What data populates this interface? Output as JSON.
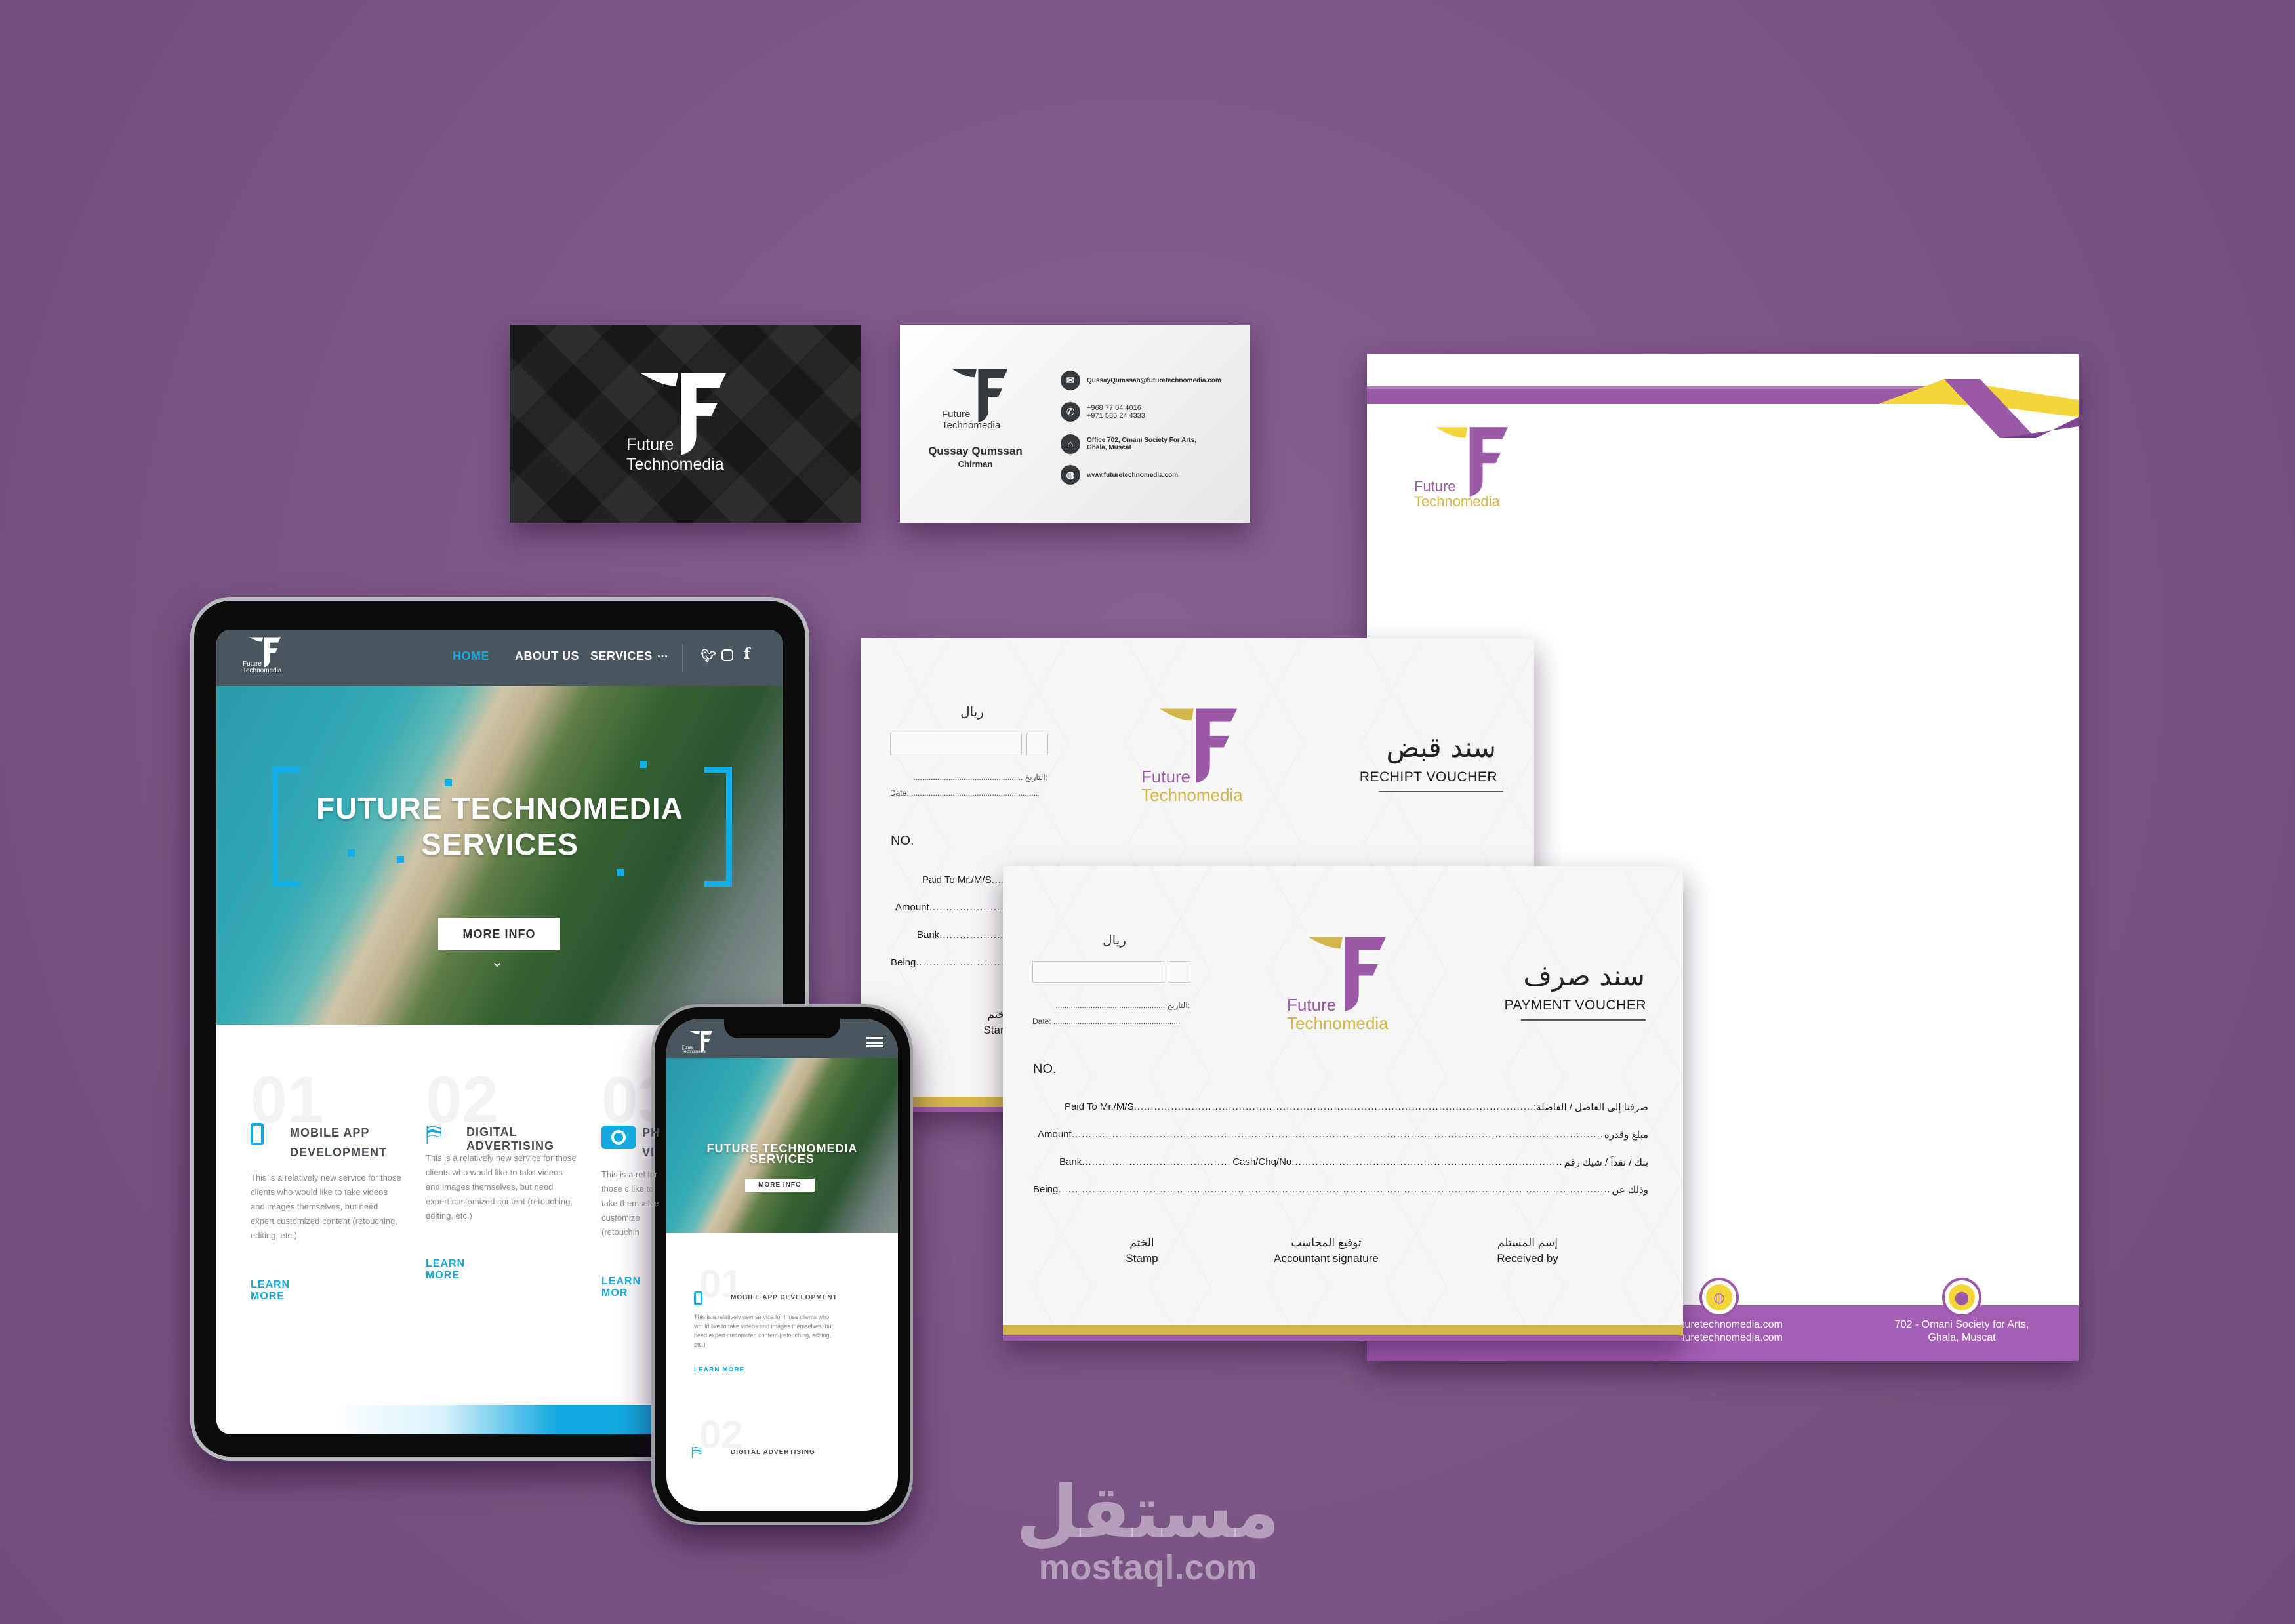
{
  "brand": {
    "line1": "Future",
    "line2": "Technomedia",
    "colors": {
      "purple": "#9b5aa8",
      "gold": "#d2b64c",
      "yellow": "#f5d63a",
      "dark": "#353a3e",
      "web_blue": "#14a9e0",
      "web_nav": "#4a565d"
    }
  },
  "business_card": {
    "name": "Qussay Qumssan",
    "title": "Chirman",
    "email": "QussayQumssan@futuretechnomedia.com",
    "phone1": "+968 77 04 4016",
    "phone2": "+971 585 24 4333",
    "address1": "Office 702, Omani Society For Arts,",
    "address2": "Ghala, Muscat",
    "website": "www.futuretechnomedia.com",
    "icons": [
      "envelope-icon",
      "phone-icon",
      "home-icon",
      "globe-icon"
    ]
  },
  "letterhead": {
    "footer_web1": "turetechnomedia.com",
    "footer_web2": "turetechnomedia.com",
    "footer_address1": "702 - Omani Society for Arts,",
    "footer_address2": "Ghala, Muscat",
    "icons": [
      "globe-icon",
      "location-pin-icon"
    ]
  },
  "receipt_voucher": {
    "title_ar": "سند قبض",
    "title_en": "RECHIPT VOUCHER",
    "currency": "ريال",
    "date_ar": "التاريخ:",
    "date_en": "Date:",
    "no": "NO.",
    "rows": [
      "Paid To Mr./M/S",
      "Amount",
      "Bank",
      "Being"
    ],
    "stamp_ar": "الختم",
    "stamp_en": "Stamp"
  },
  "payment_voucher": {
    "title_ar": "سند صرف",
    "title_en": "PAYMENT VOUCHER",
    "currency": "ريال",
    "date_ar": "التاريخ:",
    "date_en": "Date:",
    "no": "NO.",
    "rows": [
      {
        "en": "Paid To Mr./M/S",
        "ar": "صرفنا إلى الفاضل / الفاضلة:"
      },
      {
        "en": "Amount",
        "ar": "مبلغ وقدره"
      },
      {
        "en": "Bank",
        "mid": "Cash/Chq/No",
        "ar": "بنك / نقداً / شيك رقم"
      },
      {
        "en": "Being",
        "ar": "وذلك عن"
      }
    ],
    "signatures": [
      {
        "ar": "الختم",
        "en": "Stamp"
      },
      {
        "ar": "توقيع المحاسب",
        "en": "Accountant signature"
      },
      {
        "ar": "إسم المستلم",
        "en": "Received by"
      }
    ]
  },
  "website": {
    "nav": [
      "HOME",
      "ABOUT US",
      "SERVICES",
      "..."
    ],
    "active_nav": "HOME",
    "social_icons": [
      "twitter-icon",
      "instagram-icon",
      "facebook-icon"
    ],
    "hero_title1": "FUTURE TECHNOMEDIA",
    "hero_title2": "SERVICES",
    "more_info": "MORE INFO",
    "services": [
      {
        "num": "01",
        "icon": "mobile-phone-icon",
        "title1": "MOBILE APP",
        "title2": "DEVELOPMENT",
        "title": "MOBILE APP DEVELOPMENT",
        "body": "This is a relatively new service for those clients who would like to take videos and images themselves, but need expert customized content (retouching, editing, etc.)",
        "link": "LEARN MORE"
      },
      {
        "num": "02",
        "icon": "signpost-icon",
        "title": "DIGITAL ADVERTISING",
        "body": "This is a relatively new service for those clients who would like to take videos and images themselves, but need expert customized content (retouching, editing, etc.)",
        "link": "LEARN MORE"
      },
      {
        "num": "03",
        "icon": "camera-icon",
        "title1": "PH",
        "title2": "VI",
        "body": "This is a rel for those c like to take themselve customize (retouchin",
        "link": "LEARN MOR"
      }
    ]
  },
  "watermark": {
    "arabic": "مستقل",
    "latin": "mostaql.com"
  }
}
